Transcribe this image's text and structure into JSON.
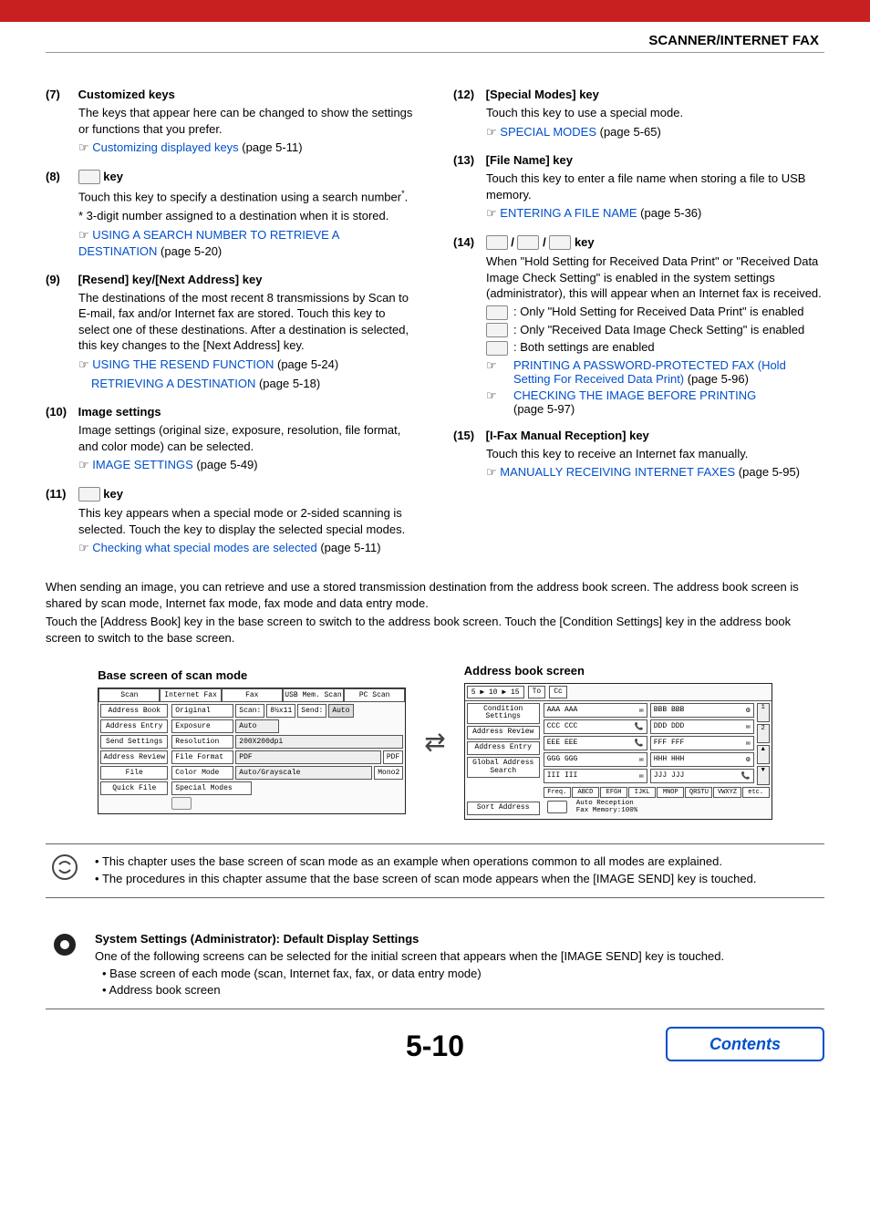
{
  "breadcrumb": "SCANNER/INTERNET FAX",
  "page_number": "5-10",
  "contents_btn": "Contents",
  "left": {
    "i7": {
      "num": "(7)",
      "title": "Customized keys",
      "body": "The keys that appear here can be changed to show the settings or functions that you prefer.",
      "link": "Customizing displayed keys",
      "after": " (page 5-11)"
    },
    "i8": {
      "num": "(8)",
      "title": "key",
      "body1": "Touch this key to specify a destination using a search number",
      "sup": "*",
      "body1b": ".",
      "body2": "* 3-digit number assigned to a destination when it is stored.",
      "link": "USING A SEARCH NUMBER TO RETRIEVE A DESTINATION",
      "after": " (page 5-20)"
    },
    "i9": {
      "num": "(9)",
      "title": "[Resend] key/[Next Address] key",
      "body": "The destinations of the most recent 8 transmissions by Scan to E-mail, fax and/or Internet fax are stored. Touch this key to select one of these destinations. After a destination is selected, this key changes to the [Next Address] key.",
      "link1": "USING THE RESEND FUNCTION",
      "after1": " (page 5-24)",
      "link2": "RETRIEVING A DESTINATION",
      "after2": " (page 5-18)"
    },
    "i10": {
      "num": "(10)",
      "title": "Image settings",
      "body": "Image settings (original size, exposure, resolution, file format, and color mode) can be selected.",
      "link": "IMAGE SETTINGS",
      "after": " (page 5-49)"
    },
    "i11": {
      "num": "(11)",
      "title": "key",
      "body": "This key appears when a special mode or 2-sided scanning is selected. Touch the key to display the selected special modes.",
      "link": "Checking what special modes are selected",
      "after": " (page 5-11)"
    }
  },
  "right": {
    "i12": {
      "num": "(12)",
      "title": "[Special Modes] key",
      "body": "Touch this key to use a special mode.",
      "link": "SPECIAL MODES",
      "after": " (page 5-65)"
    },
    "i13": {
      "num": "(13)",
      "title": "[File Name] key",
      "body": "Touch this key to enter a file name when storing a file to USB memory.",
      "link": "ENTERING A FILE NAME",
      "after": " (page 5-36)"
    },
    "i14": {
      "num": "(14)",
      "title_suffix": "key",
      "body": "When \"Hold Setting for Received Data Print\" or \"Received Data Image Check Setting\" is enabled in the system settings (administrator), this will appear when an Internet fax is received.",
      "b1": ": Only \"Hold Setting for Received Data Print\" is enabled",
      "b2": ": Only \"Received Data Image Check Setting\" is enabled",
      "b3": ": Both settings are enabled",
      "link1": "PRINTING A PASSWORD-PROTECTED FAX (Hold Setting For Received Data Print)",
      "after1": " (page 5-96)",
      "link2": "CHECKING THE IMAGE BEFORE PRINTING",
      "after2": "(page 5-97)"
    },
    "i15": {
      "num": "(15)",
      "title": "[I-Fax Manual Reception] key",
      "body": "Touch this key to receive an Internet fax manually.",
      "link": "MANUALLY RECEIVING INTERNET FAXES",
      "after": " (page 5-95)"
    }
  },
  "para1": "When sending an image, you can retrieve and use a stored transmission destination from the address book screen. The address book screen is shared by scan mode, Internet fax mode, fax mode and data entry mode.",
  "para2": "Touch the [Address Book] key in the base screen to switch to the address book screen. Touch the [Condition Settings] key in the address book screen to switch to the base screen.",
  "shot1": {
    "title": "Base screen of scan mode",
    "tabs": [
      "Scan",
      "Internet Fax",
      "Fax",
      "USB Mem. Scan",
      "PC Scan"
    ],
    "left": [
      "Address Book",
      "Address Entry",
      "Send Settings",
      "Address Review",
      "File",
      "Quick File"
    ],
    "rows": [
      {
        "lbl": "Original",
        "mid": "Scan:",
        "v1": "8½x11",
        "mid2": "Send:",
        "v2": "Auto"
      },
      {
        "lbl": "Exposure",
        "v": "Auto"
      },
      {
        "lbl": "Resolution",
        "v": "200X200dpi"
      },
      {
        "lbl": "File Format",
        "v": "PDF",
        "ext": "PDF"
      },
      {
        "lbl": "Color Mode",
        "v": "Auto/Grayscale",
        "ext": "Mono2"
      },
      {
        "lbl": "Special Modes",
        "v": ""
      }
    ]
  },
  "shot2": {
    "title": "Address book screen",
    "top_nav": "5 ▶ 10 ▶ 15",
    "top_to": "To",
    "top_cc": "Cc",
    "left": [
      "Condition Settings",
      "Address Review",
      "Address Entry",
      "Global Address Search",
      "",
      "Sort Address"
    ],
    "cells": [
      [
        "AAA AAA",
        "BBB BBB"
      ],
      [
        "CCC CCC",
        "DDD DDD"
      ],
      [
        "EEE EEE",
        "FFF FFF"
      ],
      [
        "GGG GGG",
        "HHH HHH"
      ],
      [
        "III III",
        "JJJ JJJ"
      ]
    ],
    "scroll_nums": [
      "1",
      "2"
    ],
    "alpha": [
      "Freq.",
      "ABCD",
      "EFGH",
      "IJKL",
      "MNOP",
      "QRSTU",
      "VWXYZ",
      "etc."
    ],
    "foot": "Auto Reception\nFax Memory:100%"
  },
  "note1": {
    "b1": "This chapter uses the base screen of scan mode as an example when operations common to all modes are explained.",
    "b2": "The procedures in this chapter assume that the base screen of scan mode appears when the [IMAGE SEND] key is touched."
  },
  "note2": {
    "title": "System Settings (Administrator): Default Display Settings",
    "body": "One of the following screens can be selected for the initial screen that appears when the [IMAGE SEND] key is touched.",
    "li1": "Base screen of each mode (scan, Internet fax, fax, or data entry mode)",
    "li2": "Address book screen"
  }
}
